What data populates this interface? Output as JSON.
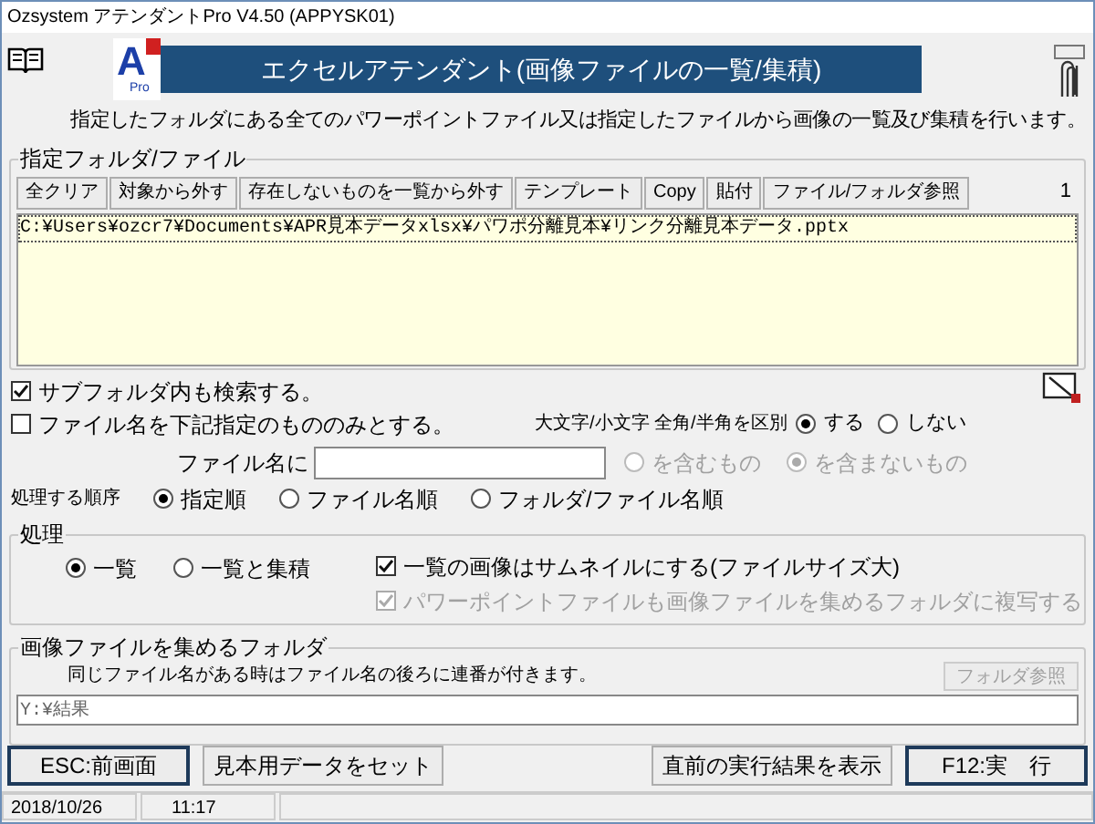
{
  "window": {
    "title": "Ozsystem アテンダントPro V4.50 (APPYSK01)"
  },
  "header": {
    "logo_letter": "A",
    "logo_sub": "Pro",
    "title": "エクセルアテンダント(画像ファイルの一覧/集積)"
  },
  "description": "指定したフォルダにある全てのパワーポイントファイル又は指定したファイルから画像の一覧及び集積を行います。",
  "file_group": {
    "label": "指定フォルダ/ファイル",
    "toolbar": [
      "全クリア",
      "対象から外す",
      "存在しないものを一覧から外す",
      "テンプレート",
      "Copy",
      "貼付",
      "ファイル/フォルダ参照"
    ],
    "count": "1",
    "files": [
      "C:¥Users¥ozcr7¥Documents¥APR見本データxlsx¥パワポ分離見本¥リンク分離見本データ.pptx"
    ]
  },
  "options": {
    "subfolder": {
      "label": "サブフォルダ内も検索する。",
      "checked": true
    },
    "filename_only": {
      "label": "ファイル名を下記指定のもののみとする。",
      "checked": false
    },
    "case_label": "大文字/小文字 全角/半角を区別",
    "case_options": [
      {
        "label": "する",
        "selected": true
      },
      {
        "label": "しない",
        "selected": false
      }
    ],
    "filename_label": "ファイル名に",
    "match_options": [
      {
        "label": "を含むもの",
        "selected": false,
        "disabled": true
      },
      {
        "label": "を含まないもの",
        "selected": true,
        "disabled": true
      }
    ],
    "order_label": "処理する順序",
    "order_options": [
      {
        "label": "指定順",
        "selected": true
      },
      {
        "label": "ファイル名順",
        "selected": false
      },
      {
        "label": "フォルダ/ファイル名順",
        "selected": false
      }
    ]
  },
  "process_group": {
    "label": "処理",
    "modes": [
      {
        "label": "一覧",
        "selected": true
      },
      {
        "label": "一覧と集積",
        "selected": false
      }
    ],
    "checks": [
      {
        "label": "一覧の画像はサムネイルにする(ファイルサイズ大)",
        "checked": true,
        "disabled": false
      },
      {
        "label": "パワーポイントファイルも画像ファイルを集めるフォルダに複写する",
        "checked": true,
        "disabled": true
      }
    ]
  },
  "collect_group": {
    "label": "画像ファイルを集めるフォルダ",
    "note": "同じファイル名がある時はファイル名の後ろに連番が付きます。",
    "browse": {
      "label": "フォルダ参照",
      "disabled": true
    },
    "path": "Y:¥結果"
  },
  "footer": [
    {
      "label": "ESC:前画面",
      "default": true
    },
    {
      "label": "見本用データをセット",
      "default": false
    },
    {
      "label": "直前の実行結果を表示",
      "default": false
    },
    {
      "label": "F12:実　行",
      "default": true
    }
  ],
  "status": {
    "date": "2018/10/26",
    "time": "11:17"
  }
}
